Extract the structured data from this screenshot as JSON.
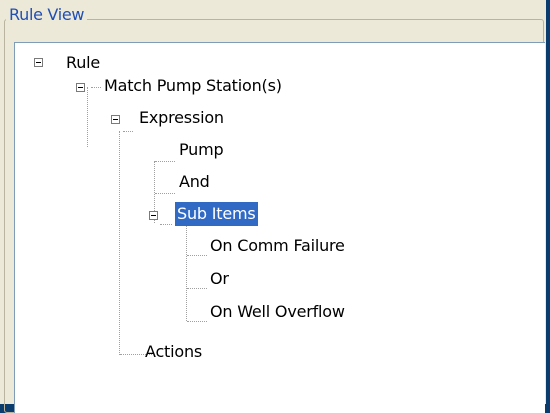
{
  "panel": {
    "title": "Rule View"
  },
  "tree": {
    "rule": "Rule",
    "match": "Match Pump Station(s)",
    "expression": "Expression",
    "pump": "Pump",
    "and": "And",
    "sub_items": "Sub Items",
    "comm_failure": "On Comm Failure",
    "or": "Or",
    "well_overflow": "On Well Overflow",
    "actions": "Actions"
  }
}
